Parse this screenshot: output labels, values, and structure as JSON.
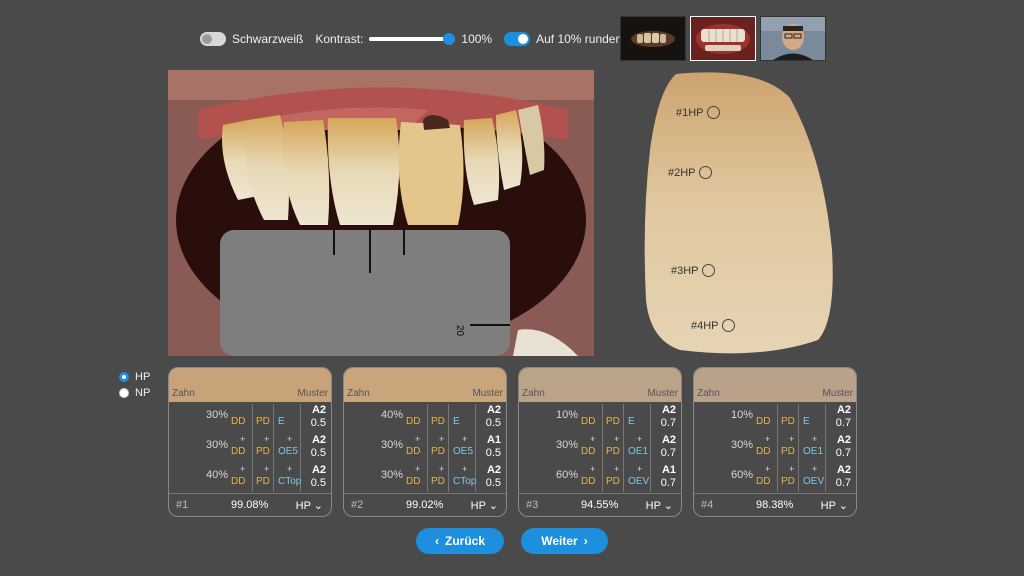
{
  "toolbar": {
    "grayscale_label": "Schwarzweiß",
    "contrast_label": "Kontrast:",
    "contrast_value": "100%",
    "contrast_level": 1.0,
    "round_label": "Auf 10% runden"
  },
  "tooth_labels": [
    "#1HP",
    "#2HP",
    "#3HP",
    "#4HP"
  ],
  "view_mode": {
    "hp": "HP",
    "np": "NP",
    "selected": "HP"
  },
  "cards": [
    {
      "zahn": "Zahn",
      "muster": "Muster",
      "color": "#c8a37a",
      "rows": [
        {
          "pct": "30%",
          "dd": "DD",
          "pd": "PD",
          "mat": "E",
          "shade": "A2",
          "frac": "0.5"
        },
        {
          "pct": "30%",
          "dd": "DD",
          "pd": "PD",
          "mat": "OE5",
          "shade": "A2",
          "frac": "0.5"
        },
        {
          "pct": "40%",
          "dd": "DD",
          "pd": "PD",
          "mat": "CTop",
          "shade": "A2",
          "frac": "0.5"
        }
      ],
      "num": "#1",
      "score": "99.08%",
      "mode": "HP"
    },
    {
      "zahn": "Zahn",
      "muster": "Muster",
      "color": "#c9a57c",
      "rows": [
        {
          "pct": "40%",
          "dd": "DD",
          "pd": "PD",
          "mat": "E",
          "shade": "A2",
          "frac": "0.5"
        },
        {
          "pct": "30%",
          "dd": "DD",
          "pd": "PD",
          "mat": "OE5",
          "shade": "A1",
          "frac": "0.5"
        },
        {
          "pct": "30%",
          "dd": "DD",
          "pd": "PD",
          "mat": "CTop",
          "shade": "A2",
          "frac": "0.5"
        }
      ],
      "num": "#2",
      "score": "99.02%",
      "mode": "HP"
    },
    {
      "zahn": "Zahn",
      "muster": "Muster",
      "color": "#bba38a",
      "rows": [
        {
          "pct": "10%",
          "dd": "DD",
          "pd": "PD",
          "mat": "E",
          "shade": "A2",
          "frac": "0.7"
        },
        {
          "pct": "30%",
          "dd": "DD",
          "pd": "PD",
          "mat": "OE1",
          "shade": "A2",
          "frac": "0.7"
        },
        {
          "pct": "60%",
          "dd": "DD",
          "pd": "PD",
          "mat": "OEV",
          "shade": "A1",
          "frac": "0.7"
        }
      ],
      "num": "#3",
      "score": "94.55%",
      "mode": "HP"
    },
    {
      "zahn": "Zahn",
      "muster": "Muster",
      "color": "#b9a18a",
      "rows": [
        {
          "pct": "10%",
          "dd": "DD",
          "pd": "PD",
          "mat": "E",
          "shade": "A2",
          "frac": "0.7"
        },
        {
          "pct": "30%",
          "dd": "DD",
          "pd": "PD",
          "mat": "OE1",
          "shade": "A2",
          "frac": "0.7"
        },
        {
          "pct": "60%",
          "dd": "DD",
          "pd": "PD",
          "mat": "OEV",
          "shade": "A2",
          "frac": "0.7"
        }
      ],
      "num": "#4",
      "score": "98.38%",
      "mode": "HP"
    }
  ],
  "nav": {
    "back": "Zurück",
    "next": "Weiter"
  },
  "photo": {
    "scale_mark": "20"
  }
}
